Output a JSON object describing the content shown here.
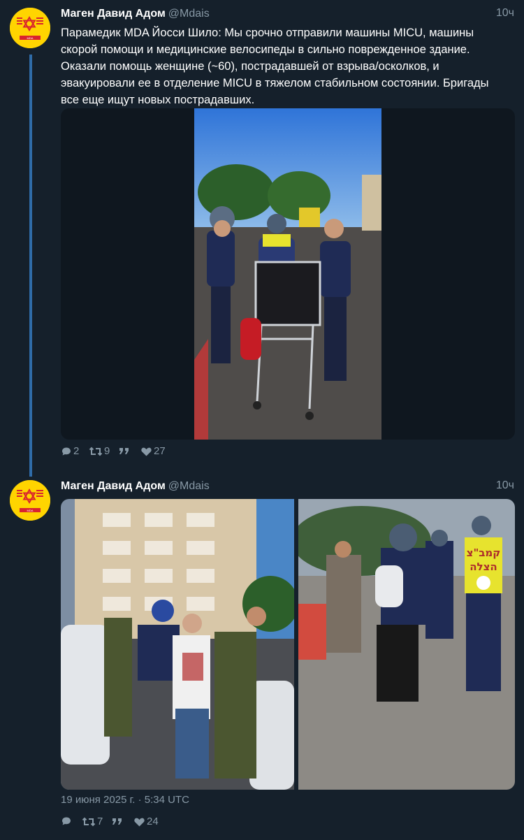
{
  "colors": {
    "background": "#15202b",
    "text_primary": "#ffffff",
    "text_secondary": "#8899a6",
    "thread_line": "#2f6ca8",
    "avatar_yellow": "#ffd400",
    "star_red": "#d9232e"
  },
  "tweets": [
    {
      "author": "Маген Давид Адом",
      "handle": "@Mdais",
      "time": "10ч",
      "avatar_text": "Magen David Adom",
      "text": "Парамедик MDA Йосси Шило: Мы срочно отправили машины MICU, машины скорой помощи и медицинские велосипеды в сильно поврежденное здание. Оказали помощь женщине (~60), пострадавшей от взрыва/осколков, и эвакуировали ее в отделение MICU в тяжелом стабильном состоянии. Бригады все еще ищут новых пострадавших.",
      "replies": "2",
      "retweets": "9",
      "likes": "27",
      "photos": [
        {
          "description_icon": "photo-paramedics-stretcher"
        }
      ]
    },
    {
      "author": "Маген Давид Адом",
      "handle": "@Mdais",
      "time": "10ч",
      "avatar_text": "Magen David Adom",
      "date": "19 июня 2025 г. · 5:34 UTC",
      "replies": "",
      "retweets": "7",
      "likes": "24",
      "vest_text_1": "קמב\"צ",
      "vest_text_2": "הצלה",
      "photos": [
        {
          "description_icon": "photo-injured-man-building"
        },
        {
          "description_icon": "photo-paramedic-carrying-child"
        }
      ]
    }
  ]
}
